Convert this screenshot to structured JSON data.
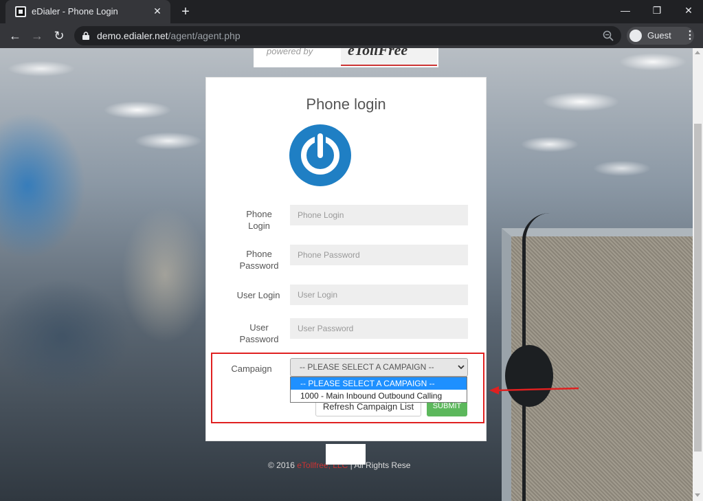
{
  "browser": {
    "tab_title": "eDialer - Phone Login",
    "url_host": "demo.edialer.net",
    "url_path": "/agent/agent.php",
    "profile_name": "Guest"
  },
  "banner": {
    "powered_by": "powered by",
    "logo_text": "eTollFree"
  },
  "login": {
    "title": "Phone login",
    "fields": [
      {
        "label": "Phone Login",
        "placeholder": "Phone Login"
      },
      {
        "label": "Phone Password",
        "placeholder": "Phone Password"
      },
      {
        "label": "User Login",
        "placeholder": "User Login"
      },
      {
        "label": "User Password",
        "placeholder": "User Password"
      }
    ],
    "campaign_label": "Campaign",
    "campaign_selected": "-- PLEASE SELECT A CAMPAIGN --",
    "campaign_options": [
      "-- PLEASE SELECT A CAMPAIGN --",
      "1000 - Main Inbound Outbound Calling"
    ],
    "refresh_button": "Refresh Campaign List",
    "submit_button": "SUBMIT"
  },
  "footer": {
    "copyright_prefix": "© 2016 ",
    "brand": "eTollfree, LLC",
    "suffix": " | All Rights Rese"
  },
  "colors": {
    "accent_blue": "#1f7fc4",
    "submit_green": "#5cb85c",
    "highlight_red": "#e02020",
    "option_selected": "#1e90ff"
  }
}
